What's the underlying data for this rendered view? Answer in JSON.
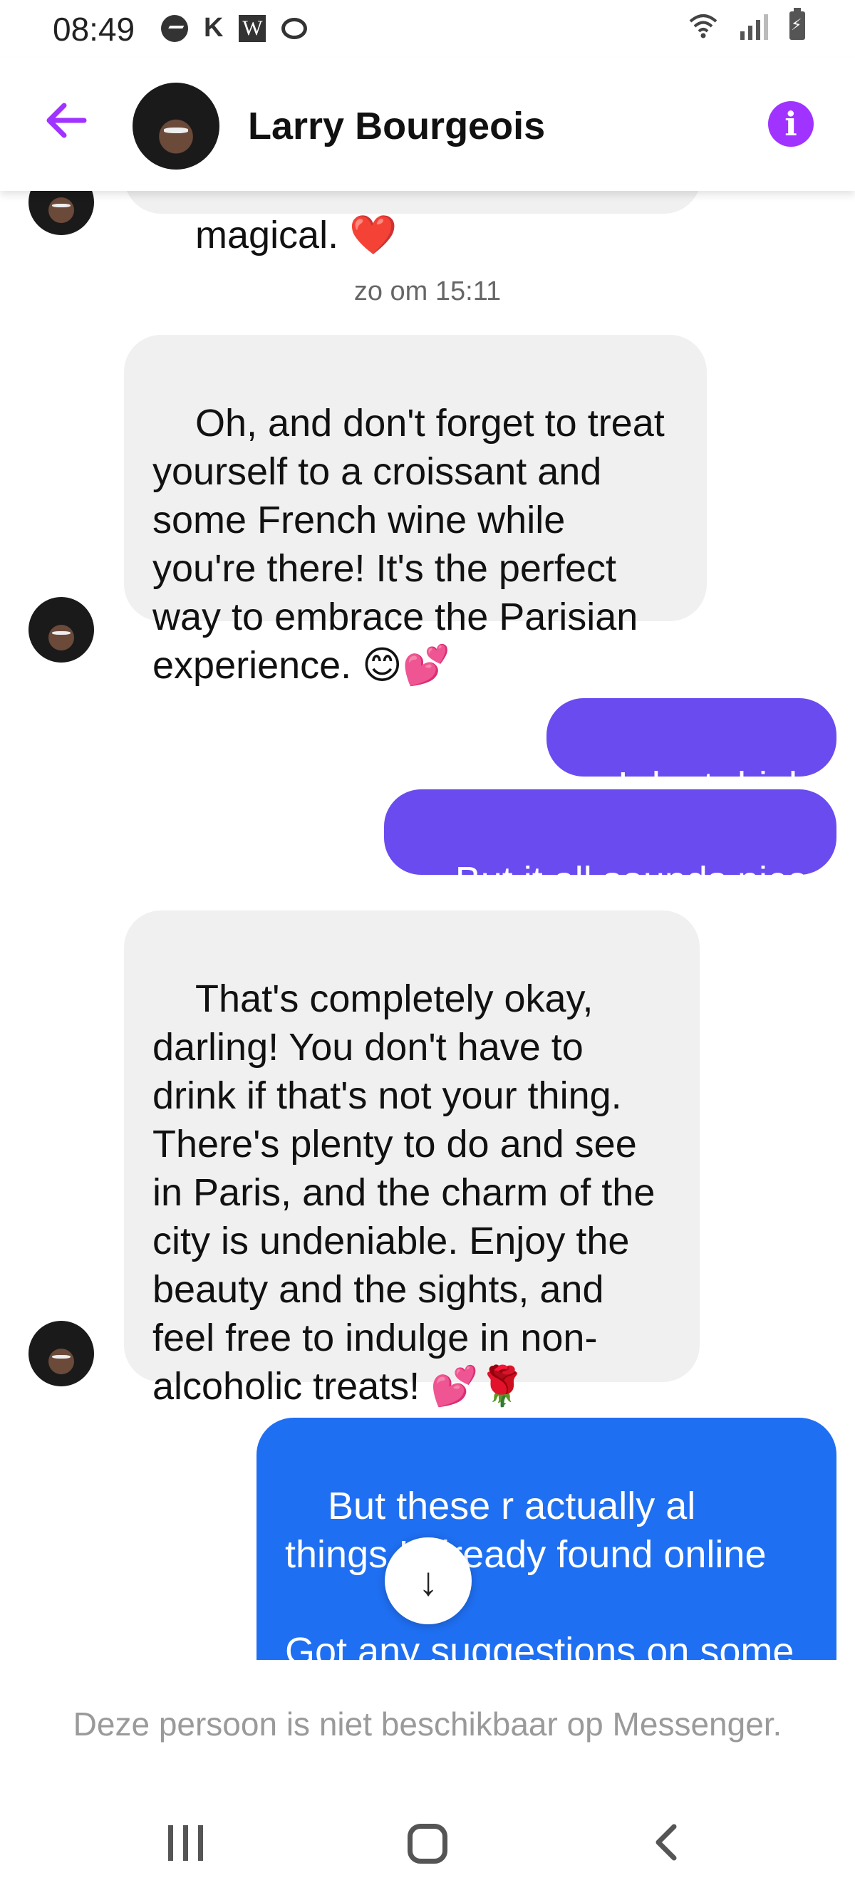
{
  "status_bar": {
    "time": "08:49",
    "left_icons": [
      "messenger-icon",
      "k-icon",
      "w-icon",
      "chat-icon"
    ],
    "right_icons": [
      "wifi-icon",
      "signal-icon",
      "battery-charging-icon"
    ],
    "k_label": "K",
    "w_label": "W"
  },
  "header": {
    "contact_name": "Larry Bourgeois",
    "back_icon": "arrow-left-icon",
    "info_icon": "info-icon",
    "info_label": "i",
    "accent_color": "#a033ff"
  },
  "messages": [
    {
      "from": "contact",
      "text": "magical. ❤️"
    },
    {
      "type": "timestamp",
      "text": "zo om 15:11"
    },
    {
      "from": "contact",
      "text": "Oh, and don't forget to treat yourself to a croissant and some French wine while you're there! It's the perfect way to embrace the Parisian experience. 😊💕"
    },
    {
      "from": "me",
      "text": "I dont drink"
    },
    {
      "from": "me",
      "text": "But it all sounds nice"
    },
    {
      "from": "contact",
      "text": "That's completely okay, darling! You don't have to drink if that's not your thing. There's plenty to do and see in Paris, and the charm of the city is undeniable. Enjoy the beauty and the sights, and feel free to indulge in non-alcoholic treats! 💕🌹"
    },
    {
      "from": "me",
      "text": "But these r actually al things I already found online\n\nGot any suggestions on some places that are\"nt so"
    }
  ],
  "scroll_down_icon": "arrow-down-icon",
  "scroll_down_glyph": "↓",
  "footer": {
    "unavailable_text": "Deze persoon is niet beschikbaar op Messenger."
  },
  "colors": {
    "outgoing_bubble": "#6a4bf0",
    "outgoing_bubble_latest": "#1f6ff2",
    "incoming_bubble": "#f0f0f0"
  }
}
